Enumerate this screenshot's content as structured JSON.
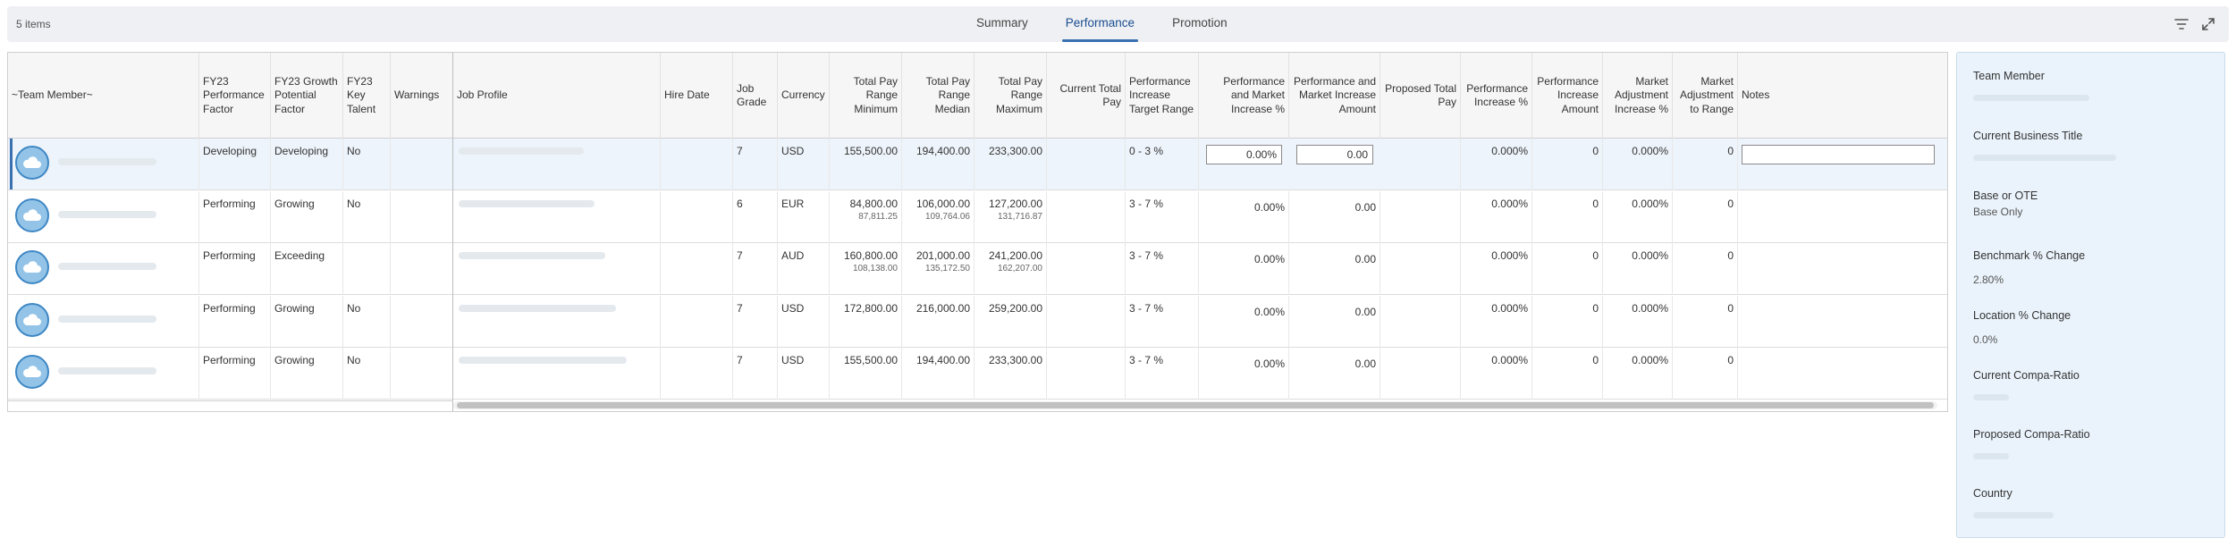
{
  "toolbar": {
    "items_count": "5 items",
    "tabs": [
      {
        "label": "Summary",
        "active": false
      },
      {
        "label": "Performance",
        "active": true
      },
      {
        "label": "Promotion",
        "active": false
      }
    ],
    "icons": [
      "filter-icon",
      "expand-icon"
    ]
  },
  "colors": {
    "accent": "#3a6fb0",
    "avatar_fill": "#93c4e8",
    "avatar_border": "#3e87c4",
    "selected_row": "#eef4fb",
    "side_panel": "#eaf3fb"
  },
  "columns": {
    "team_member": "~Team Member~",
    "perf_factor": "FY23 Performance Factor",
    "growth": "FY23 Growth Potential Factor",
    "key_talent": "FY23 Key Talent",
    "warnings": "Warnings",
    "job_profile": "Job Profile",
    "hire_date": "Hire Date",
    "job_grade": "Job Grade",
    "currency": "Currency",
    "pay_min": "Total Pay Range Minimum",
    "pay_med": "Total Pay Range Median",
    "pay_max": "Total Pay Range Maximum",
    "current_total_pay": "Current Total Pay",
    "perf_target": "Performance Increase Target Range",
    "pm_pct": "Performance and Market Increase %",
    "pm_amt": "Performance and Market Increase Amount",
    "proposed_total": "Proposed Total Pay",
    "perf_inc_pct": "Performance Increase %",
    "perf_inc_amt": "Performance Increase Amount",
    "mkt_adj_pct": "Market Adjustment Increase %",
    "mkt_adj_range": "Market Adjustment to Range",
    "notes": "Notes"
  },
  "rows": [
    {
      "perf": "Developing",
      "growth": "Developing",
      "key": "No",
      "grade": "7",
      "currency": "USD",
      "min": "155,500.00",
      "min_sub": "",
      "med": "194,400.00",
      "med_sub": "",
      "max": "233,300.00",
      "max_sub": "",
      "target": "0 - 3 %",
      "pm_pct": "0.00%",
      "pm_amt": "0.00",
      "perf_pct": "0.000%",
      "perf_amt": "0",
      "mkt_pct": "0.000%",
      "mkt_range": "0",
      "editable": true
    },
    {
      "perf": "Performing",
      "growth": "Growing",
      "key": "No",
      "grade": "6",
      "currency": "EUR",
      "min": "84,800.00",
      "min_sub": "87,811.25",
      "med": "106,000.00",
      "med_sub": "109,764.06",
      "max": "127,200.00",
      "max_sub": "131,716.87",
      "target": "3 - 7 %",
      "pm_pct": "0.00%",
      "pm_amt": "0.00",
      "perf_pct": "0.000%",
      "perf_amt": "0",
      "mkt_pct": "0.000%",
      "mkt_range": "0",
      "editable": false
    },
    {
      "perf": "Performing",
      "growth": "Exceeding",
      "key": "",
      "grade": "7",
      "currency": "AUD",
      "min": "160,800.00",
      "min_sub": "108,138.00",
      "med": "201,000.00",
      "med_sub": "135,172.50",
      "max": "241,200.00",
      "max_sub": "162,207.00",
      "target": "3 - 7 %",
      "pm_pct": "0.00%",
      "pm_amt": "0.00",
      "perf_pct": "0.000%",
      "perf_amt": "0",
      "mkt_pct": "0.000%",
      "mkt_range": "0",
      "editable": false
    },
    {
      "perf": "Performing",
      "growth": "Growing",
      "key": "No",
      "grade": "7",
      "currency": "USD",
      "min": "172,800.00",
      "min_sub": "",
      "med": "216,000.00",
      "med_sub": "",
      "max": "259,200.00",
      "max_sub": "",
      "target": "3 - 7 %",
      "pm_pct": "0.00%",
      "pm_amt": "0.00",
      "perf_pct": "0.000%",
      "perf_amt": "0",
      "mkt_pct": "0.000%",
      "mkt_range": "0",
      "editable": false
    },
    {
      "perf": "Performing",
      "growth": "Growing",
      "key": "No",
      "grade": "7",
      "currency": "USD",
      "min": "155,500.00",
      "min_sub": "",
      "med": "194,400.00",
      "med_sub": "",
      "max": "233,300.00",
      "max_sub": "",
      "target": "3 - 7 %",
      "pm_pct": "0.00%",
      "pm_amt": "0.00",
      "perf_pct": "0.000%",
      "perf_amt": "0",
      "mkt_pct": "0.000%",
      "mkt_range": "0",
      "editable": false
    }
  ],
  "side_panel": {
    "team_member": "Team Member",
    "business_title": "Current Business Title",
    "base_or_ote": "Base or OTE",
    "base_or_ote_value": "Base Only",
    "benchmark": "Benchmark % Change",
    "benchmark_value": "2.80%",
    "location": "Location % Change",
    "location_value": "0.0%",
    "current_compa": "Current Compa-Ratio",
    "proposed_compa": "Proposed Compa-Ratio",
    "country": "Country"
  }
}
